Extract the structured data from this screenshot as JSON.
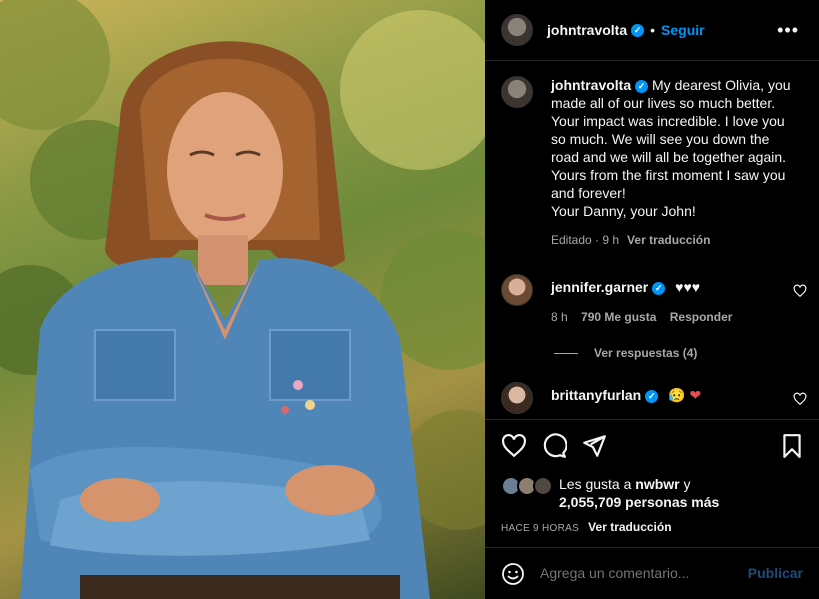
{
  "post": {
    "image_alt": "Woman with long light-brown hair wearing a blue denim shirt with embroidered flowers, arms crossed, green foliage background"
  },
  "header": {
    "username": "johntravolta",
    "separator": "•",
    "follow_label": "Seguir",
    "more_icon": "more-options-icon"
  },
  "caption": {
    "username": "johntravolta",
    "text": "My dearest Olivia, you made all of our lives so much better. Your impact was incredible. I love you so much. We will see you down the road and we will all be together again. Yours from the first moment I saw you and forever!",
    "signoff": "Your Danny, your John!",
    "edited": "Editado · 9 h",
    "translate": "Ver traducción"
  },
  "comments": [
    {
      "username": "jennifer.garner",
      "text": "♥♥♥",
      "time": "8 h",
      "likes": "790 Me gusta",
      "reply": "Responder",
      "view_replies": "Ver respuestas (4)"
    },
    {
      "username": "brittanyfurlan",
      "text": "😥",
      "heart": "❤"
    }
  ],
  "likes": {
    "prefix": "Les gusta a",
    "user": "nwbwr",
    "conj": "y",
    "count_line": "2,055,709 personas más"
  },
  "timestamp": {
    "label": "HACE 9 HORAS",
    "translate": "Ver traducción"
  },
  "composer": {
    "placeholder": "Agrega un comentario...",
    "post_label": "Publicar"
  },
  "colors": {
    "accent": "#0095f6",
    "muted": "#a8a8a8",
    "heart_red": "#ed4956"
  }
}
